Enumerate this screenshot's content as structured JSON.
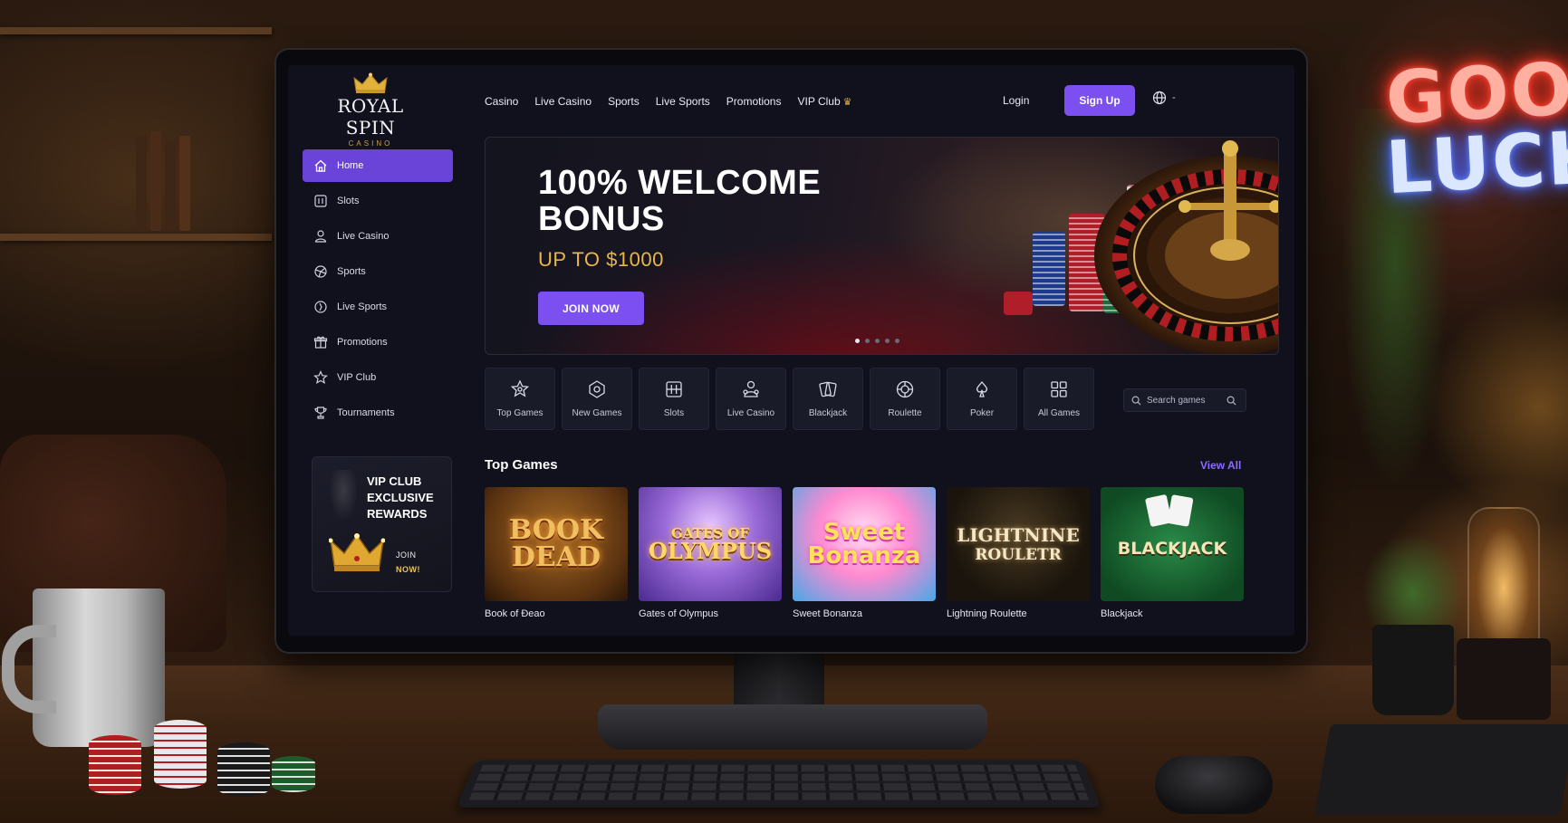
{
  "scene": {
    "neon_line1": "GOOD",
    "neon_line2": "LUCK"
  },
  "brand": {
    "name": "ROYAL SPIN",
    "tagline": "CASINO",
    "accent": "#7b4ff0",
    "gold": "#e8b64a"
  },
  "topnav": {
    "items": [
      "Casino",
      "Live Casino",
      "Sports",
      "Live Sports",
      "Promotions",
      "VIP Club"
    ],
    "login": "Login",
    "signup": "Sign Up",
    "language": "-"
  },
  "sidebar": {
    "items": [
      {
        "label": "Home",
        "icon": "home-icon",
        "active": true
      },
      {
        "label": "Slots",
        "icon": "slots-icon"
      },
      {
        "label": "Live Casino",
        "icon": "dealer-icon"
      },
      {
        "label": "Sports",
        "icon": "ball-icon"
      },
      {
        "label": "Live Sports",
        "icon": "live-sports-icon"
      },
      {
        "label": "Promotions",
        "icon": "gift-icon"
      },
      {
        "label": "VIP Club",
        "icon": "star-icon"
      },
      {
        "label": "Tournaments",
        "icon": "trophy-icon"
      }
    ],
    "vip_card": {
      "title_line1": "VIP CLUB",
      "title_line2": "EXCLUSIVE",
      "title_line3": "REWARDS",
      "cta_line1": "JOIN",
      "cta_line2": "NOW!"
    }
  },
  "hero": {
    "title_line1": "100% WELCOME",
    "title_line2": "BONUS",
    "subtitle": "UP TO $1000",
    "cta": "JOIN NOW",
    "slides": 5,
    "active_slide": 1
  },
  "categories": [
    {
      "label": "Top Games",
      "icon": "top-games-icon"
    },
    {
      "label": "New Games",
      "icon": "new-games-icon"
    },
    {
      "label": "Slots",
      "icon": "slot-machine-icon"
    },
    {
      "label": "Live Casino",
      "icon": "live-dealer-icon"
    },
    {
      "label": "Blackjack",
      "icon": "cards-icon"
    },
    {
      "label": "Roulette",
      "icon": "roulette-icon"
    },
    {
      "label": "Poker",
      "icon": "poker-icon"
    },
    {
      "label": "All Games",
      "icon": "grid-icon"
    }
  ],
  "search": {
    "placeholder": "Search games"
  },
  "top_games": {
    "title": "Top Games",
    "view_all": "View All",
    "games": [
      {
        "name": "Book of Đeao",
        "art_line1": "BOOK",
        "art_line2": "DEAD"
      },
      {
        "name": "Gates of Olympus",
        "art_line1": "GATES OF",
        "art_line2": "OLYMPUS"
      },
      {
        "name": "Sweet Bonanza",
        "art_line1": "Sweet",
        "art_line2": "Bonanza"
      },
      {
        "name": "Lightning Roulette",
        "art_line1": "LIGHTNINE",
        "art_line2": "ROULETR"
      },
      {
        "name": "Blackjack",
        "art_line1": "BLACKJACK",
        "art_line2": ""
      }
    ]
  }
}
